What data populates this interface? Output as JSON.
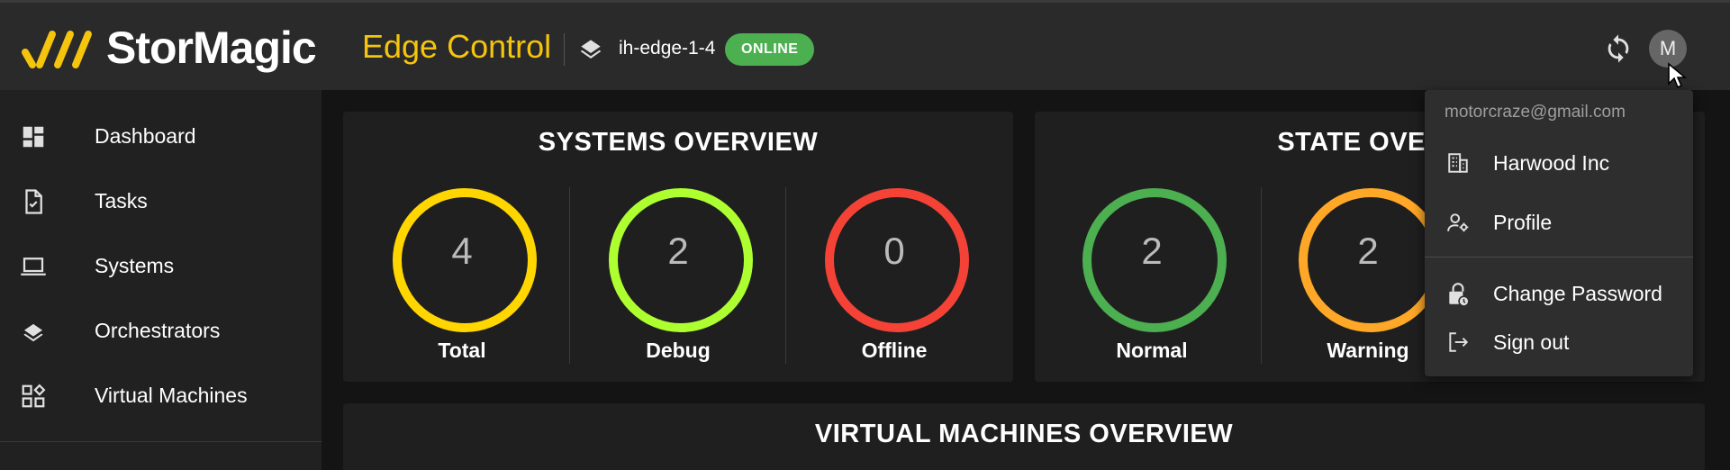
{
  "header": {
    "logo_text": "StorMagic",
    "app_title": "Edge Control",
    "environment_name": "ih-edge-1-4",
    "status_badge": "ONLINE",
    "avatar_initial": "M",
    "accent_color": "#f5c40d"
  },
  "sidebar": {
    "items": [
      {
        "label": "Dashboard",
        "icon": "dashboard-icon"
      },
      {
        "label": "Tasks",
        "icon": "task-document-icon"
      },
      {
        "label": "Systems",
        "icon": "laptop-icon"
      },
      {
        "label": "Orchestrators",
        "icon": "layers-icon"
      },
      {
        "label": "Virtual Machines",
        "icon": "apps-add-icon"
      }
    ]
  },
  "systems_overview": {
    "title": "SYSTEMS OVERVIEW",
    "stats": [
      {
        "value": "4",
        "label": "Total",
        "color": "#ffd600"
      },
      {
        "value": "2",
        "label": "Debug",
        "color": "#adff2f"
      },
      {
        "value": "0",
        "label": "Offline",
        "color": "#f44336"
      }
    ]
  },
  "state_overview": {
    "title": "STATE OVERV",
    "stats": [
      {
        "value": "2",
        "label": "Normal",
        "color": "#4caf50"
      },
      {
        "value": "2",
        "label": "Warning",
        "color": "#ffa726"
      }
    ]
  },
  "vm_overview": {
    "title": "VIRTUAL MACHINES OVERVIEW"
  },
  "user_menu": {
    "email": "motorcraze@gmail.com",
    "items": [
      {
        "label": "Harwood Inc",
        "icon": "organization-icon"
      },
      {
        "label": "Profile",
        "icon": "user-settings-icon"
      },
      {
        "label": "Change Password",
        "icon": "lock-icon"
      },
      {
        "label": "Sign out",
        "icon": "logout-icon"
      }
    ]
  }
}
